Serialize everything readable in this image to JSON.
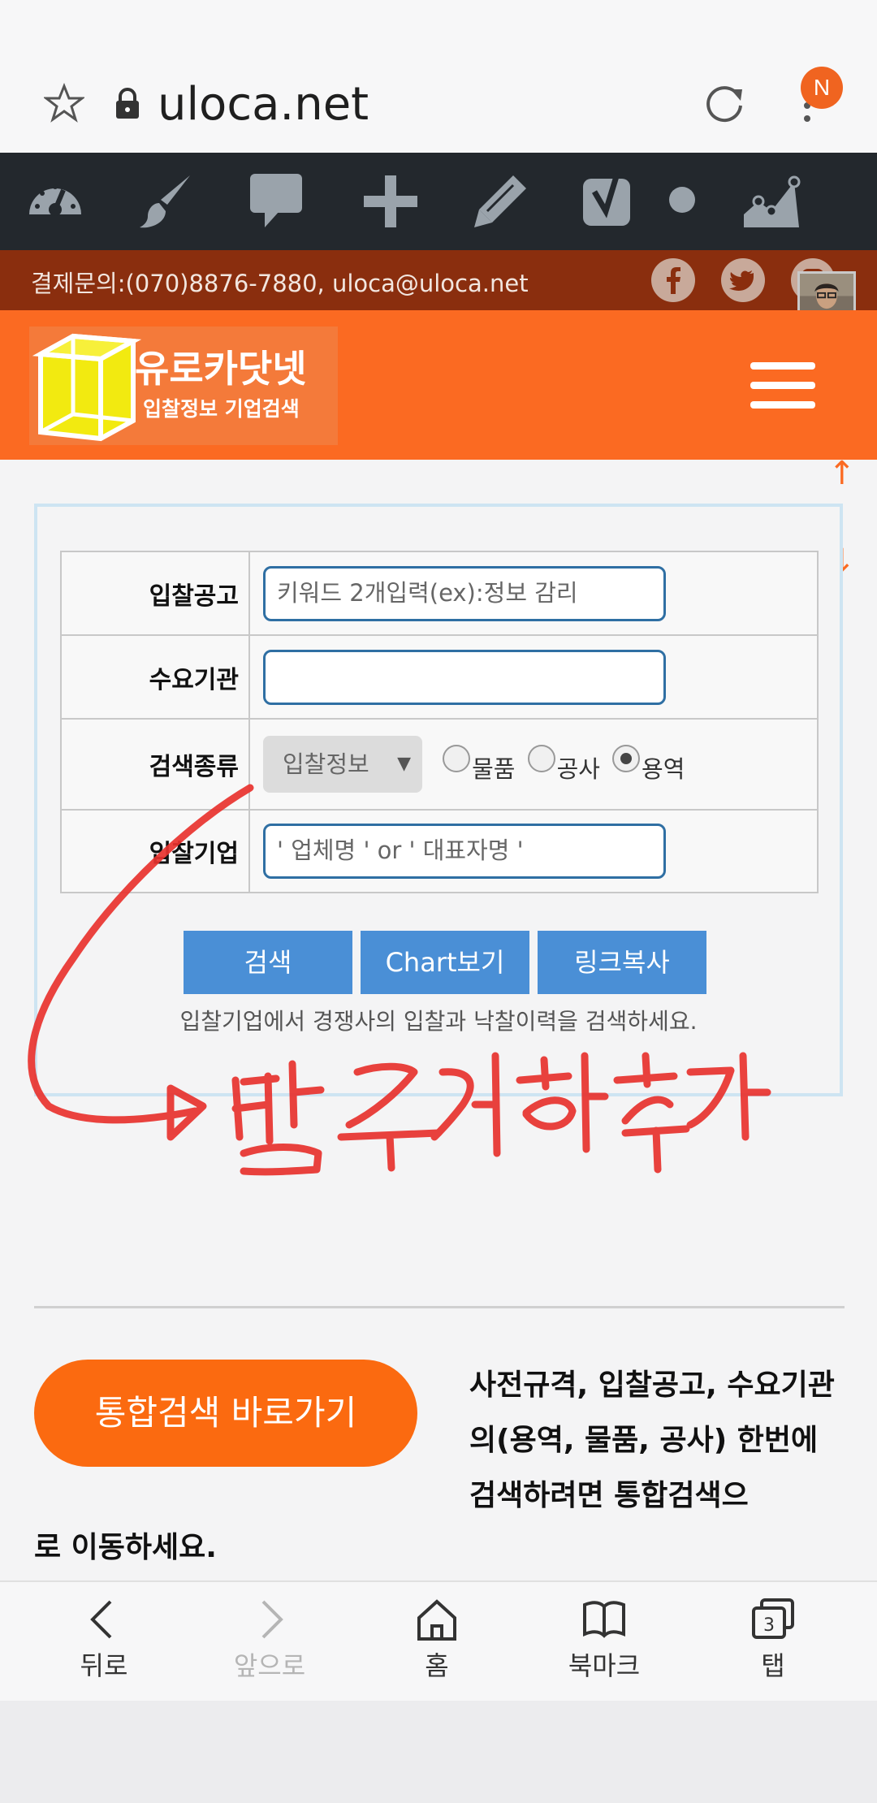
{
  "browser": {
    "url": "uloca.net",
    "profile_initial": "N"
  },
  "admin_bar": {
    "icons": [
      "dashboard-icon",
      "brush-icon",
      "comment-icon",
      "plus-icon",
      "pencil-icon",
      "yoast-icon",
      "status-dot-icon",
      "stats-chart-icon"
    ]
  },
  "contact": {
    "text": "결제문의:(070)8876-7880, uloca@uloca.net",
    "social": [
      "facebook-icon",
      "twitter-icon",
      "instagram-icon"
    ]
  },
  "site": {
    "logo_title": "유로카닷넷",
    "logo_subtitle": "입찰정보 기업검색",
    "accent": "#fb6a22"
  },
  "form": {
    "rows": [
      {
        "label": "입찰공고",
        "placeholder": "키워드 2개입력(ex):정보 감리"
      },
      {
        "label": "수요기관",
        "placeholder": ""
      },
      {
        "label": "검색종류"
      },
      {
        "label": "입찰기업",
        "placeholder": "' 업체명 ' or ' 대표자명 '"
      }
    ],
    "search_type": {
      "selected": "입찰정보",
      "options": [
        {
          "label": "물품",
          "checked": false
        },
        {
          "label": "공사",
          "checked": false
        },
        {
          "label": "용역",
          "checked": true
        }
      ]
    },
    "buttons": {
      "search": "검색",
      "chart": "Chart보기",
      "copy_link": "링크복사"
    },
    "hint": "입찰기업에서 경쟁사의 입찰과 낙찰이력을 검색하세요."
  },
  "annotation": {
    "handwritten": "발주계획 추가",
    "color": "#e8322e"
  },
  "promo": {
    "cta": "통합검색 바로가기",
    "description": "사전규격, 입찰공고, 수요기관의(용역, 물품, 공사) 한번에 검색하려면 통합검색으",
    "description_cont": "로 이동하세요."
  },
  "bottom_nav": {
    "back": "뒤로",
    "forward": "앞으로",
    "home": "홈",
    "bookmarks": "북마크",
    "tabs": "탭",
    "tab_count": "3"
  }
}
